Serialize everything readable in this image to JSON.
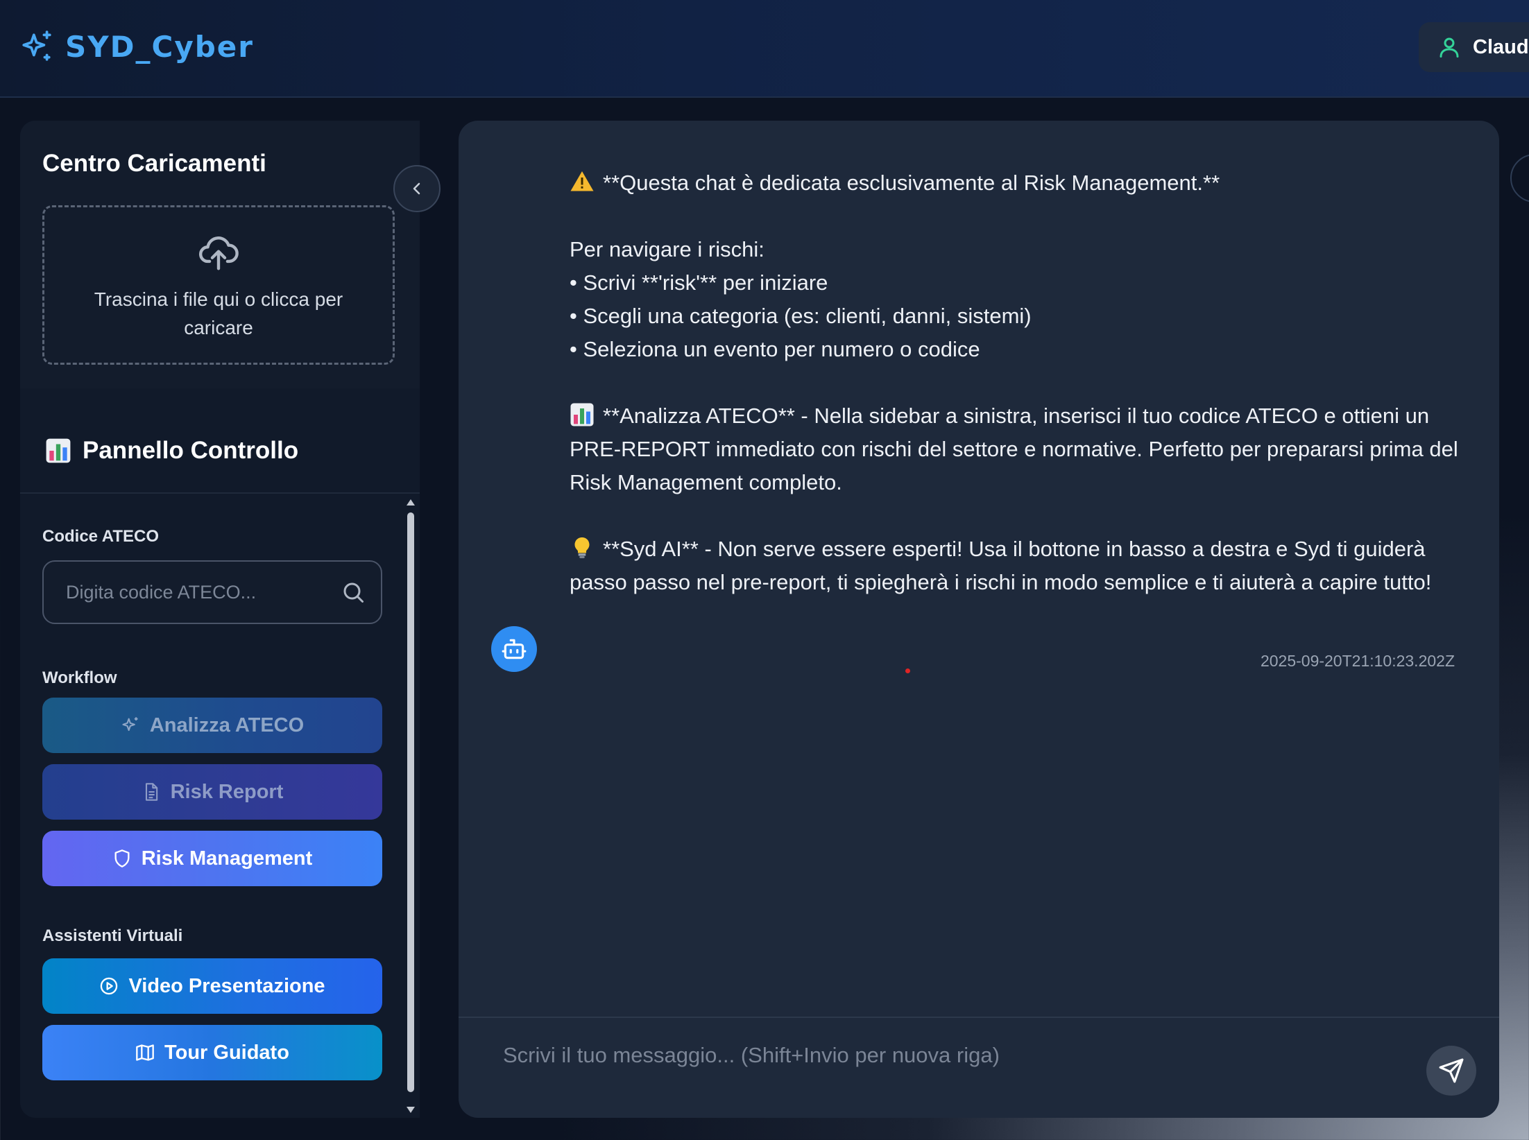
{
  "header": {
    "app_name": "SYD_Cyber",
    "user_name": "Claudio"
  },
  "sidebar": {
    "upload": {
      "title": "Centro Caricamenti",
      "dropzone_text": "Trascina i file qui o clicca per caricare"
    },
    "panel": {
      "title": "Pannello Controllo",
      "title_icon": "bar-chart-emoji"
    },
    "ateco": {
      "label": "Codice ATECO",
      "placeholder": "Digita codice ATECO...",
      "value": ""
    },
    "workflow": {
      "label": "Workflow",
      "buttons": [
        {
          "label": "Analizza ATECO",
          "icon": "sparkles-icon",
          "state": "disabled"
        },
        {
          "label": "Risk Report",
          "icon": "document-icon",
          "state": "disabled"
        },
        {
          "label": "Risk Management",
          "icon": "shield-icon",
          "state": "active"
        }
      ]
    },
    "assistants": {
      "label": "Assistenti Virtuali",
      "buttons": [
        {
          "label": "Video Presentazione",
          "icon": "play-circle-icon"
        },
        {
          "label": "Tour Guidato",
          "icon": "map-icon"
        }
      ]
    }
  },
  "chat": {
    "message": {
      "line1": "**Questa chat è dedicata esclusivamente al Risk Management.**",
      "nav_title": "Per navigare i rischi:",
      "bullet1": "• Scrivi **'risk'** per iniziare",
      "bullet2": "• Scegli una categoria (es: clienti, danni, sistemi)",
      "bullet3": "• Seleziona un evento per numero o codice",
      "ateco_para": "**Analizza ATECO** - Nella sidebar a sinistra, inserisci il tuo codice ATECO e ottieni un PRE-REPORT immediato con rischi del settore e normative. Perfetto per prepararsi prima del Risk Management completo.",
      "syd_para": "**Syd AI** - Non serve essere esperti! Usa il bottone in basso a destra e Syd ti guiderà passo passo nel pre-report, ti spiegherà i rischi in modo semplice e ti aiuterà a capire tutto!",
      "timestamp": "2025-09-20T21:10:23.202Z"
    },
    "input_placeholder": "Scrivi il tuo messaggio... (Shift+Invio per nuova riga)"
  },
  "colors": {
    "brand": "#49a8f4",
    "chat_bg": "#1e293b",
    "sidebar_bg": "#111a2a",
    "risk_management_btn": "#6366f1",
    "bot_avatar": "#2f8df2"
  }
}
